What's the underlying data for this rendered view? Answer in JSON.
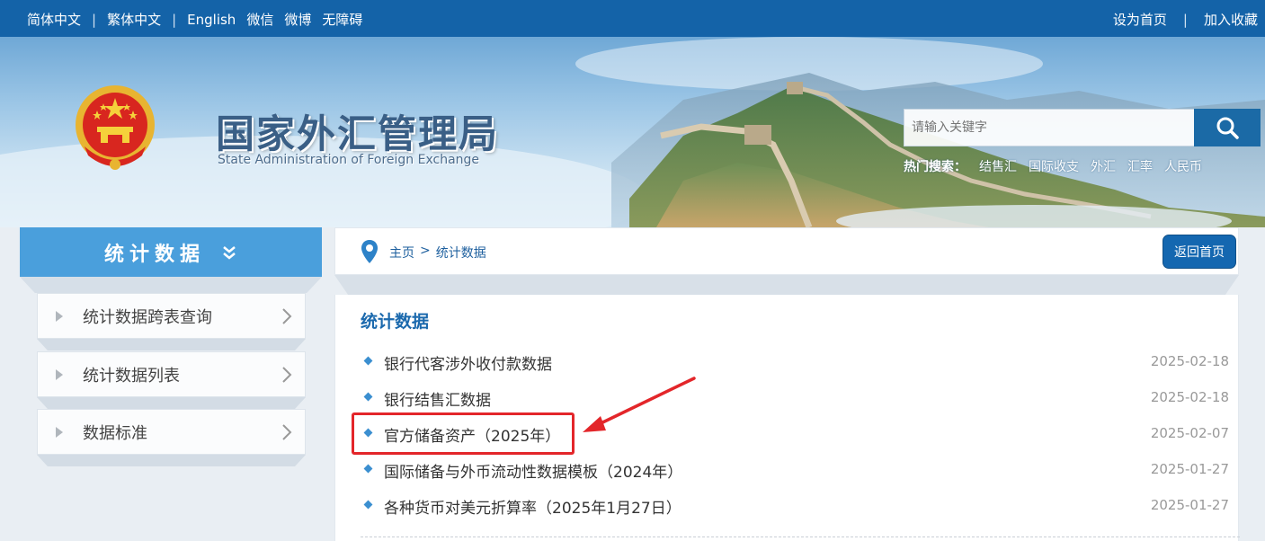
{
  "topbar": {
    "left_links": [
      "简体中文",
      "繁体中文",
      "English",
      "微信",
      "微博",
      "无障碍"
    ],
    "right_links": [
      "设为首页",
      "加入收藏"
    ],
    "separator": "|"
  },
  "banner": {
    "title": "国家外汇管理局",
    "subtitle": "State Administration of Foreign Exchange",
    "search_placeholder": "请输入关键字",
    "hot_label": "热门搜索：",
    "hot_keywords": [
      "结售汇",
      "国际收支",
      "外汇",
      "汇率",
      "人民币"
    ]
  },
  "sidebar": {
    "heading": "统计数据",
    "items": [
      {
        "label": "统计数据跨表查询"
      },
      {
        "label": "统计数据列表"
      },
      {
        "label": "数据标准"
      }
    ]
  },
  "breadcrumb": {
    "home": "主页",
    "arrow": ">",
    "current": "统计数据",
    "back_button": "返回首页"
  },
  "main": {
    "heading": "统计数据",
    "rows": [
      {
        "title": "银行代客涉外收付款数据",
        "date": "2025-02-18"
      },
      {
        "title": "银行结售汇数据",
        "date": "2025-02-18"
      },
      {
        "title": "官方储备资产（2025年）",
        "date": "2025-02-07"
      },
      {
        "title": "国际储备与外币流动性数据模板（2024年）",
        "date": "2025-01-27"
      },
      {
        "title": "各种货币对美元折算率（2025年1月27日）",
        "date": "2025-01-27"
      }
    ]
  },
  "colors": {
    "topbar": "#1463a8",
    "sidebar_head": "#4a9fdc",
    "accent_blue": "#1b69ad",
    "highlight": "#e3262a"
  }
}
